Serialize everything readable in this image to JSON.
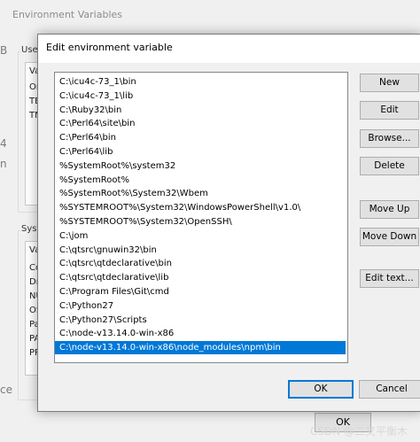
{
  "background_window": {
    "title": "Environment Variables",
    "user_group_label": "User",
    "user_header": "Va",
    "user_rows": [
      "On",
      "TE",
      "TM"
    ],
    "system_group_label": "Syste",
    "system_header": "Va",
    "system_rows": [
      "Co",
      "Dr",
      "NU",
      "OS",
      "Pa",
      "PA",
      "PR"
    ],
    "ok_label": "OK",
    "edge_chars": [
      "B",
      "4",
      "n",
      "ce"
    ]
  },
  "dialog": {
    "title": "Edit environment variable",
    "path_entries": [
      "C:\\icu4c-73_1\\bin",
      "C:\\icu4c-73_1\\lib",
      "C:\\Ruby32\\bin",
      "C:\\Perl64\\site\\bin",
      "C:\\Perl64\\bin",
      "C:\\Perl64\\lib",
      "%SystemRoot%\\system32",
      "%SystemRoot%",
      "%SystemRoot%\\System32\\Wbem",
      "%SYSTEMROOT%\\System32\\WindowsPowerShell\\v1.0\\",
      "%SYSTEMROOT%\\System32\\OpenSSH\\",
      "C:\\jom",
      "C:\\qtsrc\\gnuwin32\\bin",
      "C:\\qtsrc\\qtdeclarative\\bin",
      "C:\\qtsrc\\qtdeclarative\\lib",
      "C:\\Program Files\\Git\\cmd",
      "C:\\Python27",
      "C:\\Python27\\Scripts",
      "C:\\node-v13.14.0-win-x86",
      "C:\\node-v13.14.0-win-x86\\node_modules\\npm\\bin"
    ],
    "selected_entry": "C:\\node-v13.14.0-win-x86\\node_modules\\npm\\bin",
    "buttons": {
      "new": "New",
      "edit": "Edit",
      "browse": "Browse...",
      "delete": "Delete",
      "move_up": "Move Up",
      "move_down": "Move Down",
      "edit_text": "Edit text...",
      "ok": "OK",
      "cancel": "Cancel"
    }
  },
  "watermark": "CSDN @二叉平衡木",
  "colors": {
    "selection": "#0078d7",
    "default_button_border": "#0078d7",
    "button_face": "#e1e1e1",
    "window_bg": "#f0f0f0"
  }
}
